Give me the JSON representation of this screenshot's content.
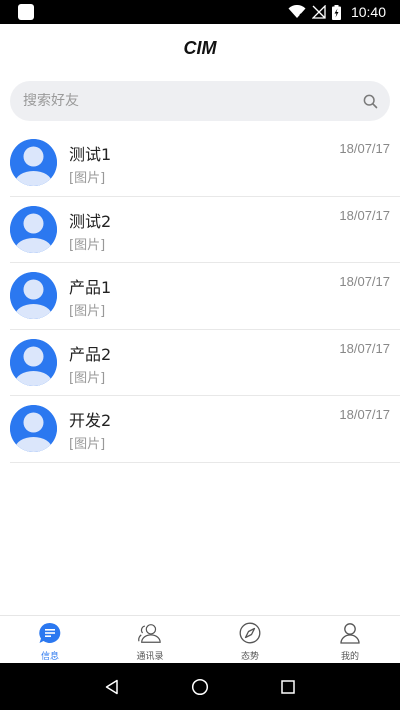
{
  "status_bar": {
    "time": "10:40",
    "icons": [
      "app-indicator-icon",
      "wifi-icon",
      "no-signal-icon",
      "battery-charging-icon"
    ]
  },
  "header": {
    "title": "CIM"
  },
  "search": {
    "placeholder": "搜索好友",
    "icon": "search-icon"
  },
  "conversations": [
    {
      "name": "测试1",
      "preview": "[图片]",
      "time": "18/07/17"
    },
    {
      "name": "测试2",
      "preview": "[图片]",
      "time": "18/07/17"
    },
    {
      "name": "产品1",
      "preview": "[图片]",
      "time": "18/07/17"
    },
    {
      "name": "产品2",
      "preview": "[图片]",
      "time": "18/07/17"
    },
    {
      "name": "开发2",
      "preview": "[图片]",
      "time": "18/07/17"
    }
  ],
  "tabs": [
    {
      "label": "信息",
      "icon": "chat-bubble-icon",
      "active": true
    },
    {
      "label": "通讯录",
      "icon": "contacts-icon",
      "active": false
    },
    {
      "label": "态势",
      "icon": "compass-icon",
      "active": false
    },
    {
      "label": "我的",
      "icon": "person-icon",
      "active": false
    }
  ],
  "nav_bar": {
    "buttons": [
      "back-icon",
      "home-icon",
      "recents-icon"
    ]
  },
  "colors": {
    "accent": "#2b78f0",
    "avatar_bg": "#2b78f0",
    "search_bg": "#eeeff2",
    "text_primary": "#222222",
    "text_secondary": "#999999"
  }
}
